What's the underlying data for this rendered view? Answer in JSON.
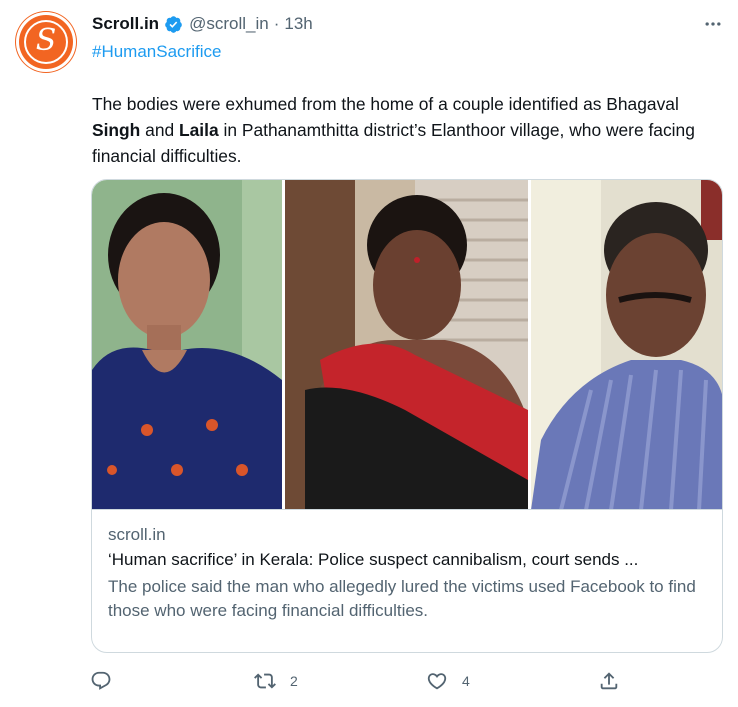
{
  "author": {
    "display_name": "Scroll.in",
    "handle": "@scroll_in",
    "separator": "·",
    "time": "13h",
    "avatar_letter": "S",
    "verified": true
  },
  "tweet": {
    "hashtag": "#HumanSacrifice",
    "text_part1": "The bodies were exhumed from the home of a couple identified as Bhagaval ",
    "bold1": "Singh",
    "text_part2": " and ",
    "bold2": "Laila",
    "text_part3": " in Pathanamthitta district’s Elanthoor village, who were facing financial difficulties."
  },
  "card": {
    "domain": "scroll.in",
    "title": "‘Human sacrifice’ in Kerala: Police suspect cannibalism, court sends ...",
    "description": "The police said the man who allegedly lured the victims used Facebook to find those who were facing financial difficulties."
  },
  "actions": {
    "reply_count": "",
    "retweet_count": "2",
    "like_count": "4",
    "share_count": ""
  },
  "colors": {
    "brand_orange": "#f26522",
    "link_blue": "#1d9bf0",
    "secondary_text": "#536471",
    "border": "#cfd9de"
  },
  "icons": [
    "verified-badge-icon",
    "more-icon",
    "reply-icon",
    "retweet-icon",
    "like-icon",
    "share-icon"
  ]
}
